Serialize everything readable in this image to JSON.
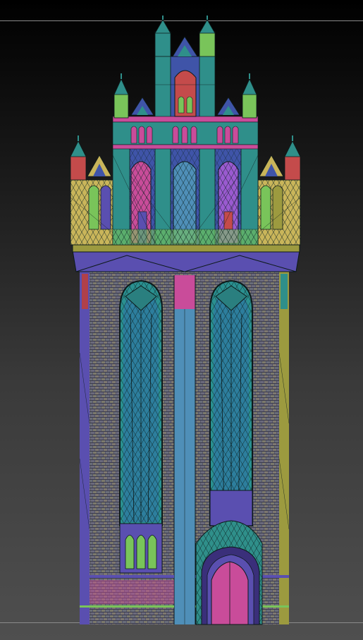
{
  "viewport": {
    "background_top": "#000000",
    "background_bottom": "#4f4f4f",
    "guide_line_color": "#8a8a8a"
  },
  "model": {
    "subject": "gothic-brick-tower-wireframe",
    "palette": {
      "blue": "#3f54a8",
      "purple": "#5a4fb0",
      "teal": "#2f8f8a",
      "green": "#79c45a",
      "pink": "#c94c9a",
      "red": "#c44b4b",
      "olive": "#9c9a3f",
      "gold": "#c9b55a",
      "steel": "#4f8fb8",
      "brick": "#5a5a68",
      "wire": "#0d1a1a"
    }
  }
}
